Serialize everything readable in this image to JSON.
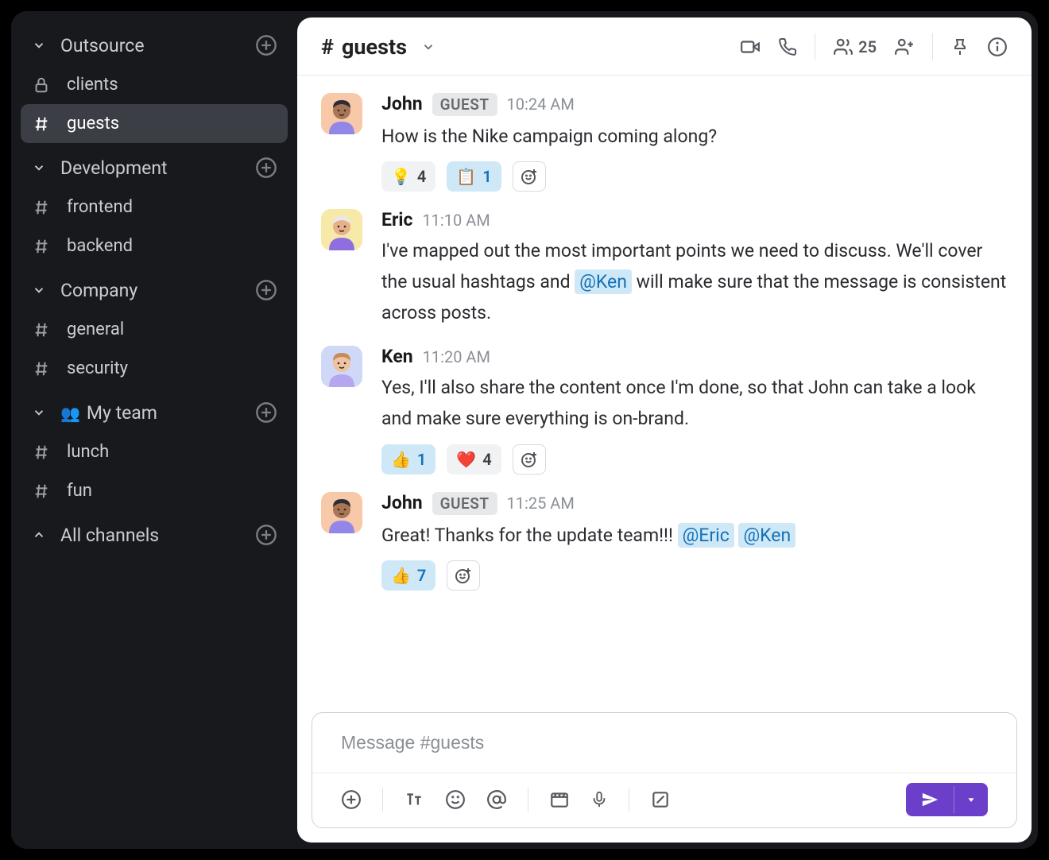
{
  "sidebar": {
    "sections": [
      {
        "title": "Outsource",
        "expanded": true,
        "items": [
          {
            "label": "clients",
            "icon": "lock",
            "active": false
          },
          {
            "label": "guests",
            "icon": "hash",
            "active": true
          }
        ]
      },
      {
        "title": "Development",
        "expanded": true,
        "items": [
          {
            "label": "frontend",
            "icon": "hash",
            "active": false
          },
          {
            "label": "backend",
            "icon": "hash",
            "active": false
          }
        ]
      },
      {
        "title": "Company",
        "expanded": true,
        "items": [
          {
            "label": "general",
            "icon": "hash",
            "active": false
          },
          {
            "label": "security",
            "icon": "hash",
            "active": false
          }
        ]
      },
      {
        "title": "My team",
        "team_icon": "👥",
        "expanded": true,
        "items": [
          {
            "label": "lunch",
            "icon": "hash",
            "active": false
          },
          {
            "label": "fun",
            "icon": "hash",
            "active": false
          }
        ]
      },
      {
        "title": "All channels",
        "expanded": false,
        "items": []
      }
    ]
  },
  "header": {
    "hash": "#",
    "channel": "guests",
    "member_count": "25"
  },
  "messages": [
    {
      "author": "John",
      "badge": "GUEST",
      "time": "10:24 AM",
      "avatar_bg": "#f7c9a8",
      "avatar_shirt": "#9287e8",
      "avatar_hair": "#2d2d36",
      "avatar_skin": "#a87654",
      "text_parts": [
        {
          "t": "How is the Nike campaign coming along?"
        }
      ],
      "reactions": [
        {
          "emoji": "💡",
          "count": "4",
          "active": false
        },
        {
          "emoji": "📋",
          "count": "1",
          "active": true
        }
      ]
    },
    {
      "author": "Eric",
      "badge": "",
      "time": "11:10 AM",
      "avatar_bg": "#f7eaa8",
      "avatar_shirt": "#8f6fe0",
      "avatar_hair": "#e8e8ea",
      "avatar_skin": "#e8b088",
      "text_parts": [
        {
          "t": "I've mapped out the most important points we need to discuss. We'll cover the usual hashtags and "
        },
        {
          "t": "@Ken",
          "mention": true
        },
        {
          "t": " will make sure that the message is consistent across posts."
        }
      ],
      "reactions": []
    },
    {
      "author": "Ken",
      "badge": "",
      "time": "11:20 AM",
      "avatar_bg": "#cfd8f7",
      "avatar_shirt": "#b4a6ef",
      "avatar_hair": "#c78b5a",
      "avatar_skin": "#efc2a0",
      "text_parts": [
        {
          "t": "Yes, I'll also share the content once I'm done, so that John can take a look and make sure everything is on-brand."
        }
      ],
      "reactions": [
        {
          "emoji": "👍",
          "count": "1",
          "active": true
        },
        {
          "emoji": "❤️",
          "count": "4",
          "active": false
        }
      ]
    },
    {
      "author": "John",
      "badge": "GUEST",
      "time": "11:25 AM",
      "avatar_bg": "#f7c9a8",
      "avatar_shirt": "#9287e8",
      "avatar_hair": "#2d2d36",
      "avatar_skin": "#a87654",
      "text_parts": [
        {
          "t": "Great! Thanks for the update team!!! "
        },
        {
          "t": "@Eric",
          "mention": true
        },
        {
          "t": " "
        },
        {
          "t": "@Ken",
          "mention": true
        }
      ],
      "reactions": [
        {
          "emoji": "👍",
          "count": "7",
          "active": true
        }
      ]
    }
  ],
  "composer": {
    "placeholder": "Message #guests"
  }
}
